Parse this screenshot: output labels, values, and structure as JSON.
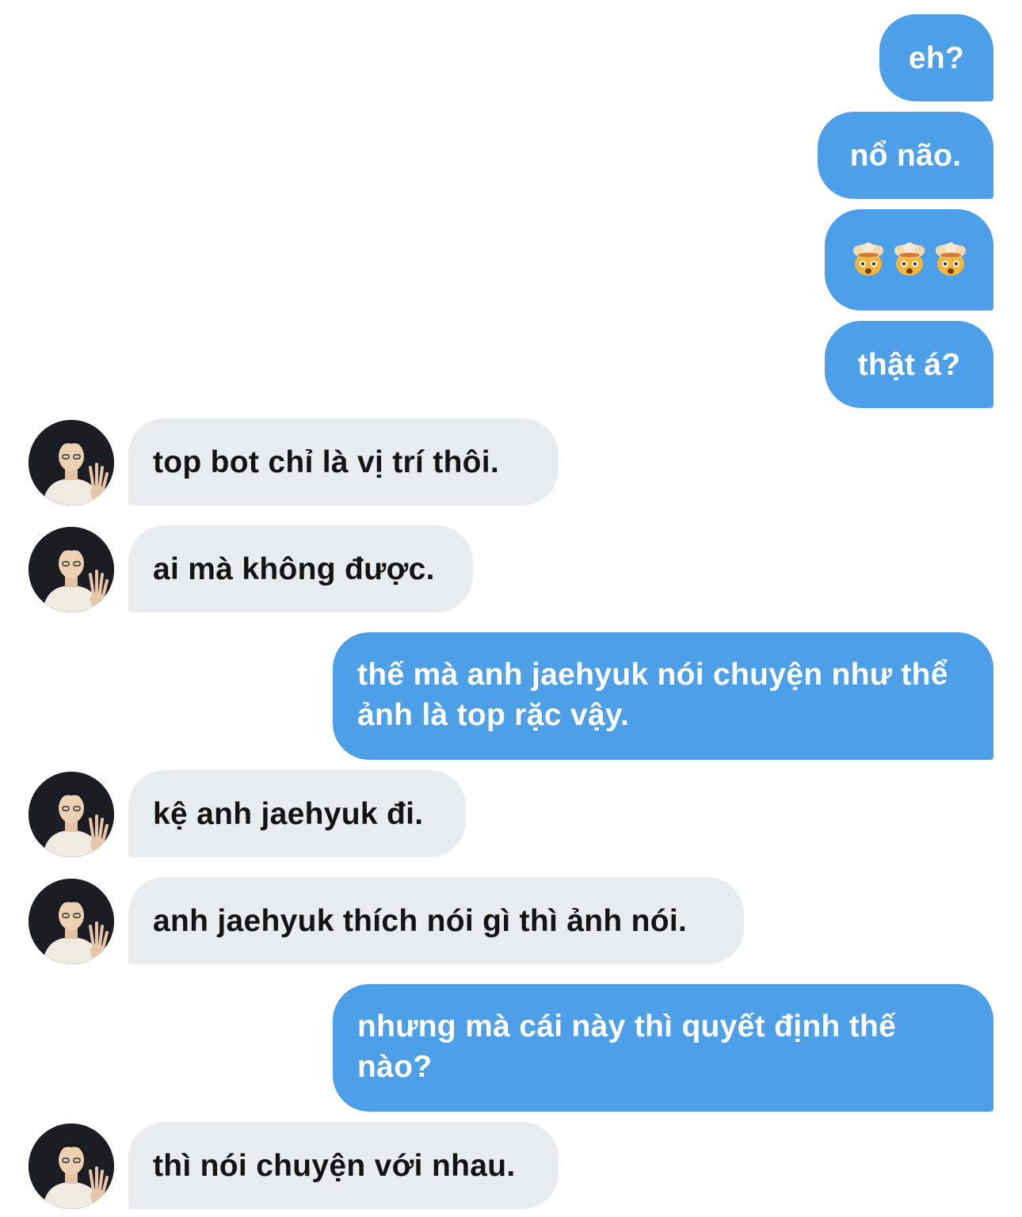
{
  "conversation": {
    "messages": [
      {
        "side": "sent",
        "text": "eh?"
      },
      {
        "side": "sent",
        "text": "nổ não."
      },
      {
        "side": "sent",
        "emoji": "exploding-head-emoji",
        "count": 3
      },
      {
        "side": "sent",
        "text": "thật á?"
      },
      {
        "side": "received",
        "text": "top bot chỉ là vị trí thôi."
      },
      {
        "side": "received",
        "text": "ai mà không được."
      },
      {
        "side": "sent",
        "text": "thế mà anh jaehyuk nói chuyện như thể ảnh là top rặc vậy."
      },
      {
        "side": "received",
        "text": "kệ anh jaehyuk đi."
      },
      {
        "side": "received",
        "text": "anh jaehyuk thích nói gì thì ảnh nói."
      },
      {
        "side": "sent",
        "text": "nhưng mà cái này thì quyết định thế nào?"
      },
      {
        "side": "received",
        "text": "thì nói chuyện với nhau."
      }
    ]
  },
  "colors": {
    "sent_bubble": "#4d9fe8",
    "received_bubble": "#e9ecef",
    "sent_text": "#ffffff",
    "received_text": "#141414"
  }
}
